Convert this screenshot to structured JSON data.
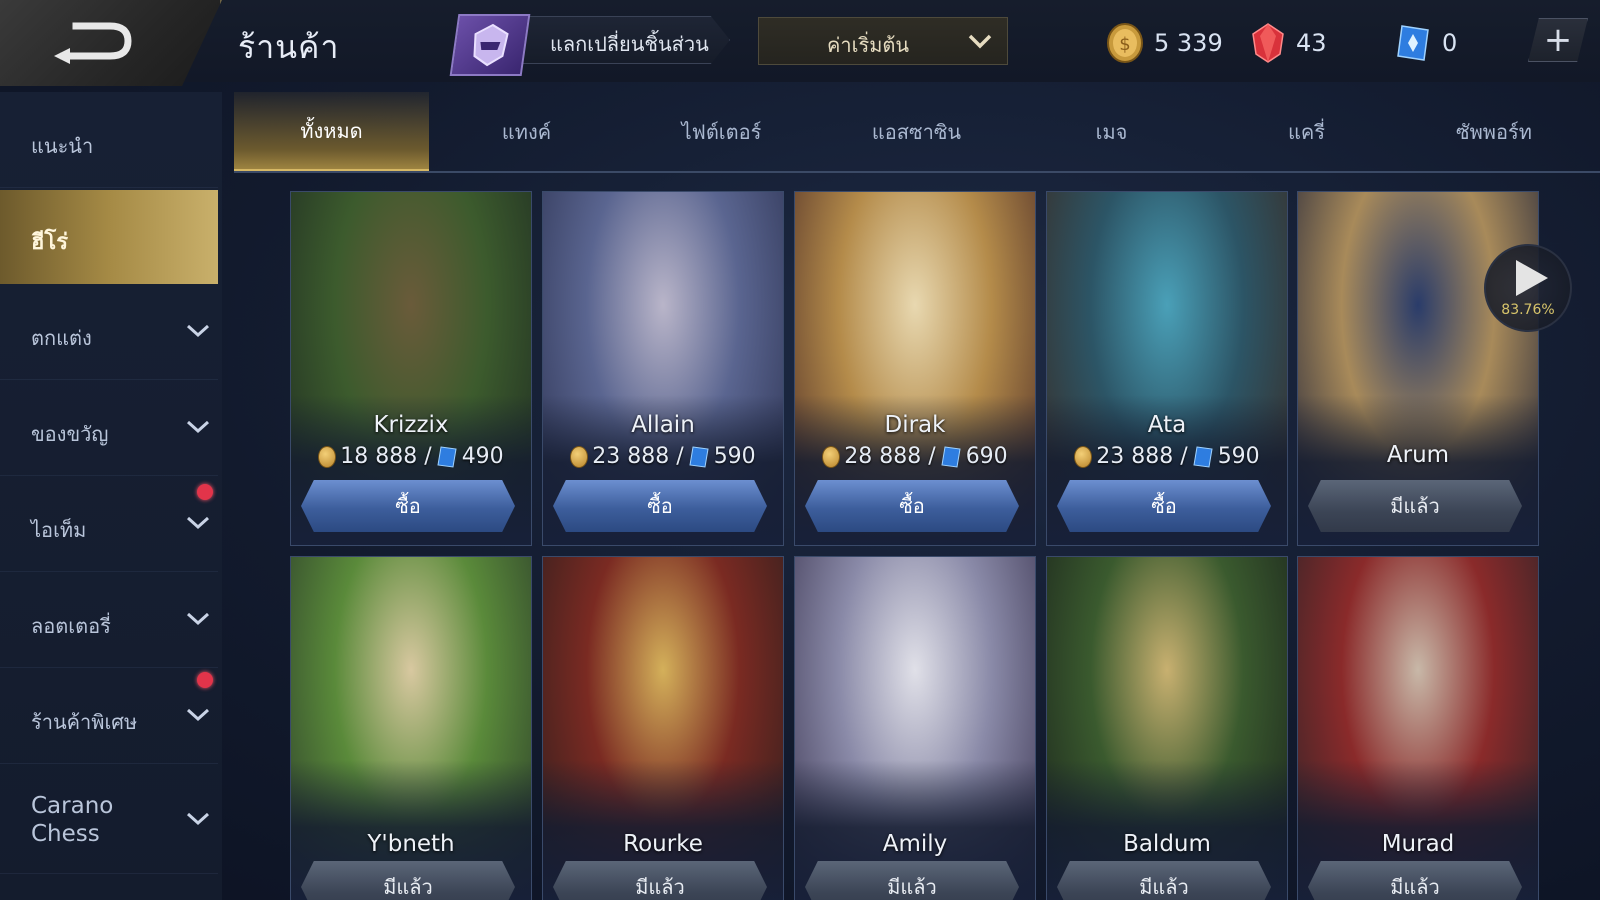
{
  "header": {
    "title": "ร้านค้า",
    "exchange_label": "แลกเปลี่ยนชิ้นส่วน",
    "sort_value": "ค่าเริ่มต้น",
    "currencies": [
      {
        "name": "gold-coin",
        "value": "5 339"
      },
      {
        "name": "red-diamond",
        "value": "43"
      },
      {
        "name": "blue-voucher",
        "value": "0"
      }
    ]
  },
  "sidebar": {
    "items": [
      {
        "label": "แนะนำ",
        "has_chevron": false,
        "active": false,
        "dot": false
      },
      {
        "label": "ฮีโร่",
        "has_chevron": false,
        "active": true,
        "dot": false
      },
      {
        "label": "ตกแต่ง",
        "has_chevron": true,
        "active": false,
        "dot": false
      },
      {
        "label": "ของขวัญ",
        "has_chevron": true,
        "active": false,
        "dot": false
      },
      {
        "label": "ไอเท็ม",
        "has_chevron": true,
        "active": false,
        "dot": true
      },
      {
        "label": "ลอตเตอรี่",
        "has_chevron": true,
        "active": false,
        "dot": false
      },
      {
        "label": "ร้านค้าพิเศษ",
        "has_chevron": true,
        "active": false,
        "dot": true
      },
      {
        "label": "Carano Chess",
        "has_chevron": true,
        "active": false,
        "dot": false
      }
    ]
  },
  "tabs": [
    {
      "label": "ทั้งหมด",
      "active": true
    },
    {
      "label": "แทงค์",
      "active": false
    },
    {
      "label": "ไฟต์เตอร์",
      "active": false
    },
    {
      "label": "แอสซาซิน",
      "active": false
    },
    {
      "label": "เมจ",
      "active": false
    },
    {
      "label": "แครี่",
      "active": false
    },
    {
      "label": "ซัพพอร์ท",
      "active": false
    }
  ],
  "heroes": [
    {
      "name": "Krizzix",
      "gold": "18 888 /",
      "voucher": "490",
      "button": "ซื้อ",
      "owned": false,
      "colors": [
        "#6a5b3a",
        "#3c5b2d",
        "#1e2b22"
      ]
    },
    {
      "name": "Allain",
      "gold": "23 888 /",
      "voucher": "590",
      "button": "ซื้อ",
      "owned": false,
      "colors": [
        "#b9b5c9",
        "#5a6590",
        "#2b3150"
      ]
    },
    {
      "name": "Dirak",
      "gold": "28 888 /",
      "voucher": "690",
      "button": "ซื้อ",
      "owned": false,
      "colors": [
        "#e8d8b0",
        "#b48b4a",
        "#4a2a26"
      ]
    },
    {
      "name": "Ata",
      "gold": "23 888 /",
      "voucher": "590",
      "button": "ซื้อ",
      "owned": false,
      "colors": [
        "#4aa0b8",
        "#2c5566",
        "#3a2a22"
      ]
    },
    {
      "name": "Arum",
      "gold": "",
      "voucher": "",
      "button": "มีแล้ว",
      "owned": true,
      "colors": [
        "#2a3c6a",
        "#a88a5a",
        "#1e2238"
      ]
    },
    {
      "name": "Y'bneth",
      "gold": "",
      "voucher": "",
      "button": "มีแล้ว",
      "owned": true,
      "colors": [
        "#d8c8a0",
        "#5a8a3a",
        "#2a3a2a"
      ]
    },
    {
      "name": "Rourke",
      "gold": "",
      "voucher": "",
      "button": "มีแล้ว",
      "owned": true,
      "colors": [
        "#d4b05a",
        "#7a2a22",
        "#2a1e1e"
      ]
    },
    {
      "name": "Amily",
      "gold": "",
      "voucher": "",
      "button": "มีแล้ว",
      "owned": true,
      "colors": [
        "#e0e0e8",
        "#8a8aa8",
        "#3a3450"
      ]
    },
    {
      "name": "Baldum",
      "gold": "",
      "voucher": "",
      "button": "มีแล้ว",
      "owned": true,
      "colors": [
        "#c8b070",
        "#3a5a2e",
        "#1a221c"
      ]
    },
    {
      "name": "Murad",
      "gold": "",
      "voucher": "",
      "button": "มีแล้ว",
      "owned": true,
      "colors": [
        "#c8b8a8",
        "#8a2a2a",
        "#2a2428"
      ]
    }
  ],
  "play_indicator": {
    "percent": "83.76%"
  },
  "accent": {
    "gold": "#c9b06b",
    "blue": "#3d5e9c",
    "red_dot": "#e2344a"
  }
}
